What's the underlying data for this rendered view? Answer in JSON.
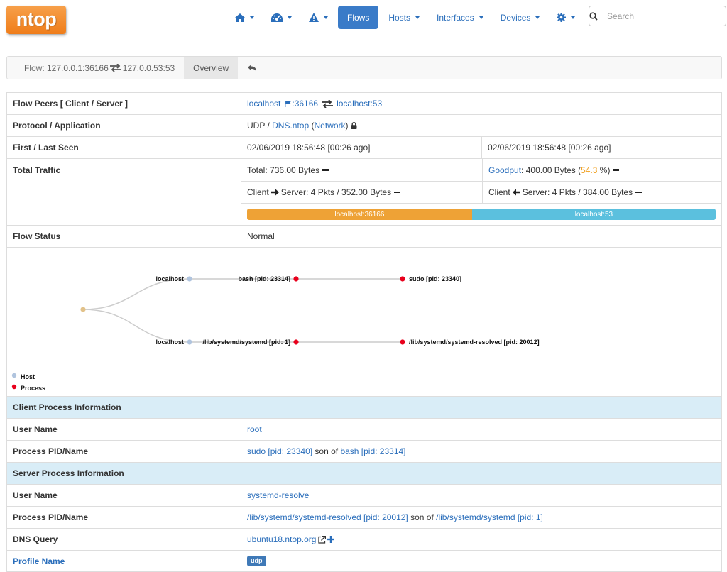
{
  "navbar": {
    "logo": "ntop",
    "items": [
      {
        "icon": "home-icon"
      },
      {
        "icon": "dashboard-icon"
      },
      {
        "icon": "alert-icon"
      },
      {
        "label": "Flows"
      },
      {
        "label": "Hosts"
      },
      {
        "label": "Interfaces"
      },
      {
        "label": "Devices"
      },
      {
        "icon": "gear-icon"
      }
    ],
    "search_placeholder": "Search"
  },
  "breadcrumb": {
    "flow_label": "Flow: 127.0.0.1:36166",
    "flow_server": "127.0.0.53:53",
    "tab_overview": "Overview"
  },
  "flow": {
    "peers": {
      "label": "Flow Peers [ Client / Server ]",
      "client": "localhost",
      "client_port": ":36166",
      "server": "localhost",
      "server_port": ":53"
    },
    "protocol": {
      "label": "Protocol / Application",
      "proto": "UDP / ",
      "app": "DNS.ntop",
      "paren_open": " (",
      "category": "Network",
      "paren_close": ")"
    },
    "seen": {
      "label": "First / Last Seen",
      "first": "02/06/2019 18:56:48 [00:26 ago]",
      "last": "02/06/2019 18:56:48 [00:26 ago]"
    },
    "traffic": {
      "label": "Total Traffic",
      "total": "Total: 736.00 Bytes",
      "goodput_label": "Goodput",
      "goodput_value": ": 400.00 Bytes (",
      "goodput_pct": "54.3",
      "goodput_suffix": " %)",
      "c2s_prefix": "Client",
      "c2s_suffix": "Server: 4 Pkts / 352.00 Bytes",
      "s2c_prefix": "Client",
      "s2c_suffix": "Server: 4 Pkts / 384.00 Bytes",
      "bar_client": "localhost:36166",
      "bar_server": "localhost:53",
      "bar_client_fraction": 0.48
    },
    "status": {
      "label": "Flow Status",
      "value": "Normal"
    }
  },
  "graph": {
    "nodes": {
      "host1": "localhost",
      "proc1": "bash [pid: 23314]",
      "proc2": "sudo [pid: 23340]",
      "host2": "localhost",
      "proc3": "/lib/systemd/systemd [pid: 1]",
      "proc4": "/lib/systemd/systemd-resolved [pid: 20012]"
    },
    "legend": {
      "host": "Host",
      "process": "Process"
    },
    "colors": {
      "host": "#b0c4de",
      "process": "#e8001c",
      "root": "#e2c28a",
      "link": "#cccccc"
    }
  },
  "client_proc": {
    "title": "Client Process Information",
    "user_label": "User Name",
    "user": "root",
    "pid_label": "Process PID/Name",
    "proc": "sudo [pid: 23340]",
    "son_of": " son of ",
    "parent": "bash [pid: 23314]"
  },
  "server_proc": {
    "title": "Server Process Information",
    "user_label": "User Name",
    "user": "systemd-resolve",
    "pid_label": "Process PID/Name",
    "proc": "/lib/systemd/systemd-resolved [pid: 20012]",
    "son_of": " son of ",
    "parent": "/lib/systemd/systemd [pid: 1]"
  },
  "dns": {
    "label": "DNS Query",
    "value": "ubuntu18.ntop.org"
  },
  "profile": {
    "label": "Profile Name",
    "value": "udp"
  }
}
